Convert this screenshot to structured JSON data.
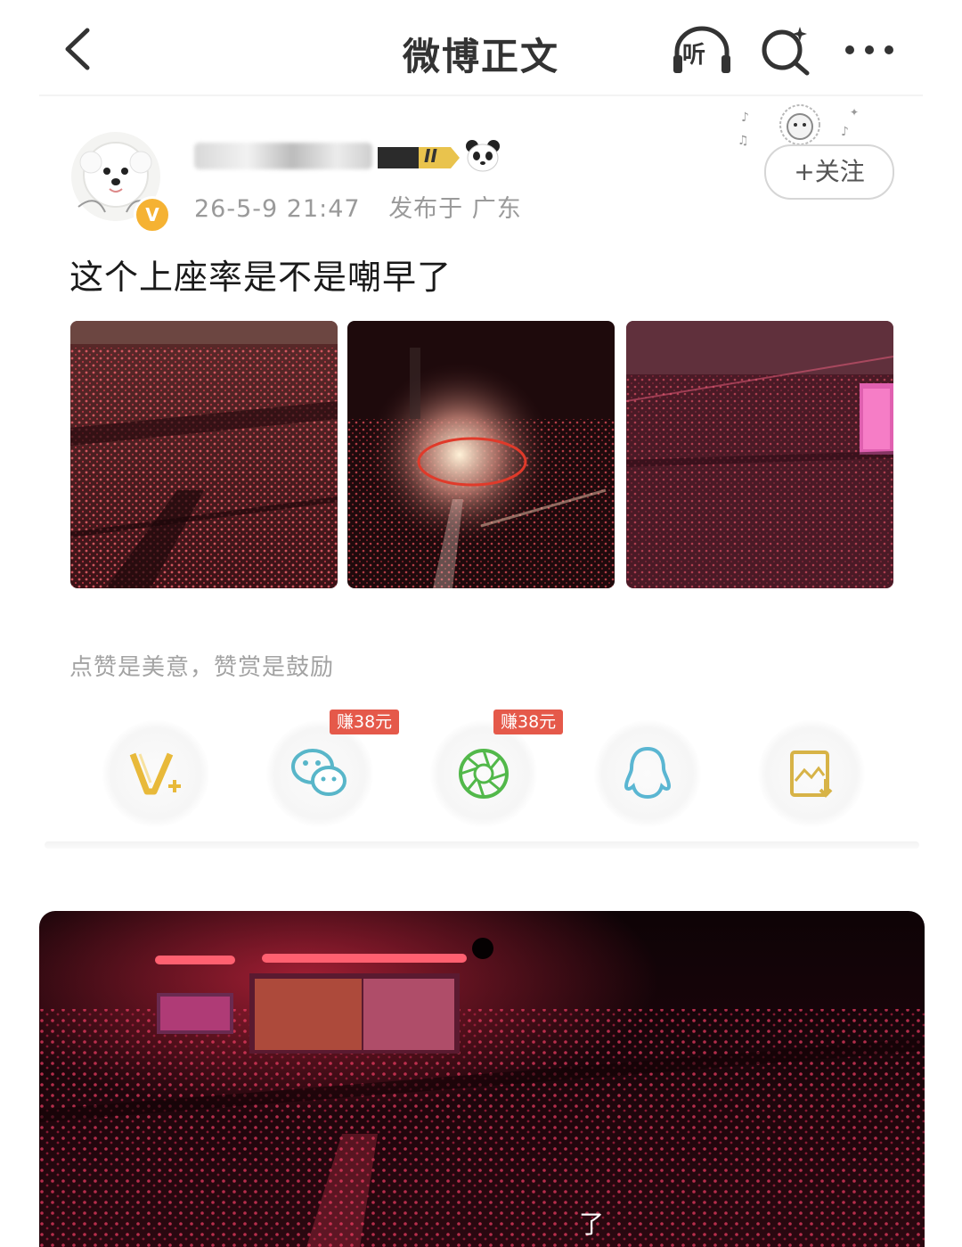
{
  "nav": {
    "title": "微博正文",
    "listen_label": "听"
  },
  "author": {
    "verified_badge": "V",
    "level_badge": "II",
    "time": "26-5-9 21:47",
    "location": "发布于 广东",
    "follow_label": "+关注"
  },
  "post": {
    "text": "这个上座率是不是嘲早了",
    "photos": [
      "arena-photo-1",
      "arena-photo-2",
      "arena-photo-3"
    ]
  },
  "reward_text": "点赞是美意，赞赏是鼓励",
  "share": {
    "earn_badge_1": "赚38元",
    "earn_badge_2": "赚38元",
    "items": [
      "vplus-icon",
      "wechat-icon",
      "moments-icon",
      "qq-icon",
      "save-image-icon"
    ]
  },
  "bottom_image": {
    "caption": "了"
  },
  "colors": {
    "earn_badge": "#e5594a",
    "vplus": "#e8b93a",
    "wechat": "#58b6c9",
    "moments": "#52b84a",
    "qq": "#5ab6d2",
    "save": "#d7b347",
    "verified": "#f5b233"
  }
}
